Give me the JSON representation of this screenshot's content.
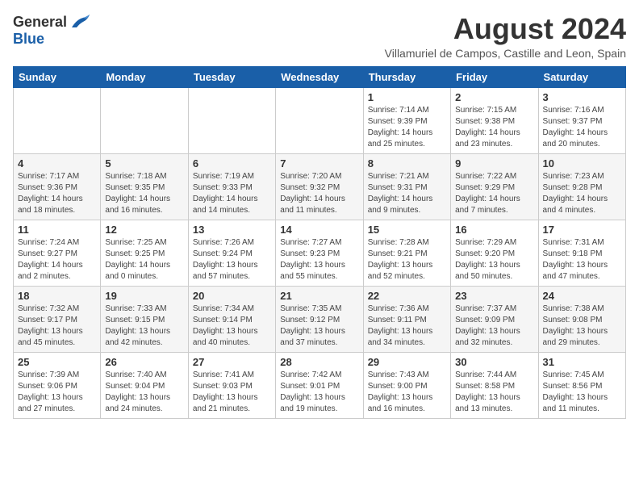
{
  "logo": {
    "general": "General",
    "blue": "Blue"
  },
  "title": {
    "month_year": "August 2024",
    "location": "Villamuriel de Campos, Castille and Leon, Spain"
  },
  "weekdays": [
    "Sunday",
    "Monday",
    "Tuesday",
    "Wednesday",
    "Thursday",
    "Friday",
    "Saturday"
  ],
  "weeks": [
    [
      {
        "day": "",
        "info": ""
      },
      {
        "day": "",
        "info": ""
      },
      {
        "day": "",
        "info": ""
      },
      {
        "day": "",
        "info": ""
      },
      {
        "day": "1",
        "info": "Sunrise: 7:14 AM\nSunset: 9:39 PM\nDaylight: 14 hours\nand 25 minutes."
      },
      {
        "day": "2",
        "info": "Sunrise: 7:15 AM\nSunset: 9:38 PM\nDaylight: 14 hours\nand 23 minutes."
      },
      {
        "day": "3",
        "info": "Sunrise: 7:16 AM\nSunset: 9:37 PM\nDaylight: 14 hours\nand 20 minutes."
      }
    ],
    [
      {
        "day": "4",
        "info": "Sunrise: 7:17 AM\nSunset: 9:36 PM\nDaylight: 14 hours\nand 18 minutes."
      },
      {
        "day": "5",
        "info": "Sunrise: 7:18 AM\nSunset: 9:35 PM\nDaylight: 14 hours\nand 16 minutes."
      },
      {
        "day": "6",
        "info": "Sunrise: 7:19 AM\nSunset: 9:33 PM\nDaylight: 14 hours\nand 14 minutes."
      },
      {
        "day": "7",
        "info": "Sunrise: 7:20 AM\nSunset: 9:32 PM\nDaylight: 14 hours\nand 11 minutes."
      },
      {
        "day": "8",
        "info": "Sunrise: 7:21 AM\nSunset: 9:31 PM\nDaylight: 14 hours\nand 9 minutes."
      },
      {
        "day": "9",
        "info": "Sunrise: 7:22 AM\nSunset: 9:29 PM\nDaylight: 14 hours\nand 7 minutes."
      },
      {
        "day": "10",
        "info": "Sunrise: 7:23 AM\nSunset: 9:28 PM\nDaylight: 14 hours\nand 4 minutes."
      }
    ],
    [
      {
        "day": "11",
        "info": "Sunrise: 7:24 AM\nSunset: 9:27 PM\nDaylight: 14 hours\nand 2 minutes."
      },
      {
        "day": "12",
        "info": "Sunrise: 7:25 AM\nSunset: 9:25 PM\nDaylight: 14 hours\nand 0 minutes."
      },
      {
        "day": "13",
        "info": "Sunrise: 7:26 AM\nSunset: 9:24 PM\nDaylight: 13 hours\nand 57 minutes."
      },
      {
        "day": "14",
        "info": "Sunrise: 7:27 AM\nSunset: 9:23 PM\nDaylight: 13 hours\nand 55 minutes."
      },
      {
        "day": "15",
        "info": "Sunrise: 7:28 AM\nSunset: 9:21 PM\nDaylight: 13 hours\nand 52 minutes."
      },
      {
        "day": "16",
        "info": "Sunrise: 7:29 AM\nSunset: 9:20 PM\nDaylight: 13 hours\nand 50 minutes."
      },
      {
        "day": "17",
        "info": "Sunrise: 7:31 AM\nSunset: 9:18 PM\nDaylight: 13 hours\nand 47 minutes."
      }
    ],
    [
      {
        "day": "18",
        "info": "Sunrise: 7:32 AM\nSunset: 9:17 PM\nDaylight: 13 hours\nand 45 minutes."
      },
      {
        "day": "19",
        "info": "Sunrise: 7:33 AM\nSunset: 9:15 PM\nDaylight: 13 hours\nand 42 minutes."
      },
      {
        "day": "20",
        "info": "Sunrise: 7:34 AM\nSunset: 9:14 PM\nDaylight: 13 hours\nand 40 minutes."
      },
      {
        "day": "21",
        "info": "Sunrise: 7:35 AM\nSunset: 9:12 PM\nDaylight: 13 hours\nand 37 minutes."
      },
      {
        "day": "22",
        "info": "Sunrise: 7:36 AM\nSunset: 9:11 PM\nDaylight: 13 hours\nand 34 minutes."
      },
      {
        "day": "23",
        "info": "Sunrise: 7:37 AM\nSunset: 9:09 PM\nDaylight: 13 hours\nand 32 minutes."
      },
      {
        "day": "24",
        "info": "Sunrise: 7:38 AM\nSunset: 9:08 PM\nDaylight: 13 hours\nand 29 minutes."
      }
    ],
    [
      {
        "day": "25",
        "info": "Sunrise: 7:39 AM\nSunset: 9:06 PM\nDaylight: 13 hours\nand 27 minutes."
      },
      {
        "day": "26",
        "info": "Sunrise: 7:40 AM\nSunset: 9:04 PM\nDaylight: 13 hours\nand 24 minutes."
      },
      {
        "day": "27",
        "info": "Sunrise: 7:41 AM\nSunset: 9:03 PM\nDaylight: 13 hours\nand 21 minutes."
      },
      {
        "day": "28",
        "info": "Sunrise: 7:42 AM\nSunset: 9:01 PM\nDaylight: 13 hours\nand 19 minutes."
      },
      {
        "day": "29",
        "info": "Sunrise: 7:43 AM\nSunset: 9:00 PM\nDaylight: 13 hours\nand 16 minutes."
      },
      {
        "day": "30",
        "info": "Sunrise: 7:44 AM\nSunset: 8:58 PM\nDaylight: 13 hours\nand 13 minutes."
      },
      {
        "day": "31",
        "info": "Sunrise: 7:45 AM\nSunset: 8:56 PM\nDaylight: 13 hours\nand 11 minutes."
      }
    ]
  ]
}
